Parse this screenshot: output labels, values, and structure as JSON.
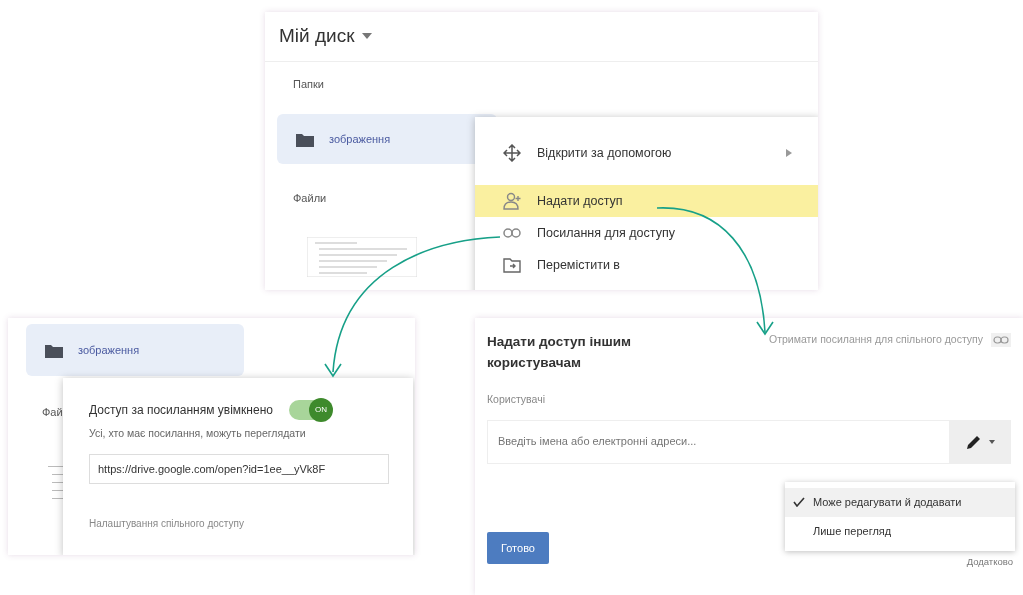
{
  "drive_window": {
    "title": "Мій диск",
    "folders_heading": "Папки",
    "folder": {
      "name": "зображення",
      "selected": true
    },
    "files_heading": "Файли",
    "context_menu": [
      {
        "kind": "open-with",
        "label": "Відкрити за допомогою",
        "has_submenu": true,
        "selected": false
      },
      {
        "kind": "share",
        "label": "Надати доступ",
        "has_submenu": false,
        "selected": true
      },
      {
        "kind": "link",
        "label": "Посилання для доступу",
        "has_submenu": false,
        "selected": false
      },
      {
        "kind": "move",
        "label": "Перемістити в",
        "has_submenu": false,
        "selected": false
      }
    ]
  },
  "link_popup": {
    "folder": "зображення",
    "files_heading": "Фай",
    "title": "Доступ за посиланням увімкнено",
    "toggle": {
      "label": "ON",
      "on": true
    },
    "description": "Усі, хто має посилання, можуть переглядати",
    "url": "https://drive.google.com/open?id=1ee__yVk8F",
    "settings_link": "Налаштування спільного доступу"
  },
  "share_dialog": {
    "title": "Надати доступ іншим користувачам",
    "get_link": "Отримати посилання для спільного доступу",
    "people_label": "Користувачі",
    "input_placeholder": "Введіть імена або електронні адреси...",
    "permission_options": [
      {
        "label": "Може редагувати й додавати",
        "selected": true
      },
      {
        "label": "Лише перегляд",
        "selected": false
      }
    ],
    "done_button": "Готово",
    "advanced_link": "Додатково"
  }
}
